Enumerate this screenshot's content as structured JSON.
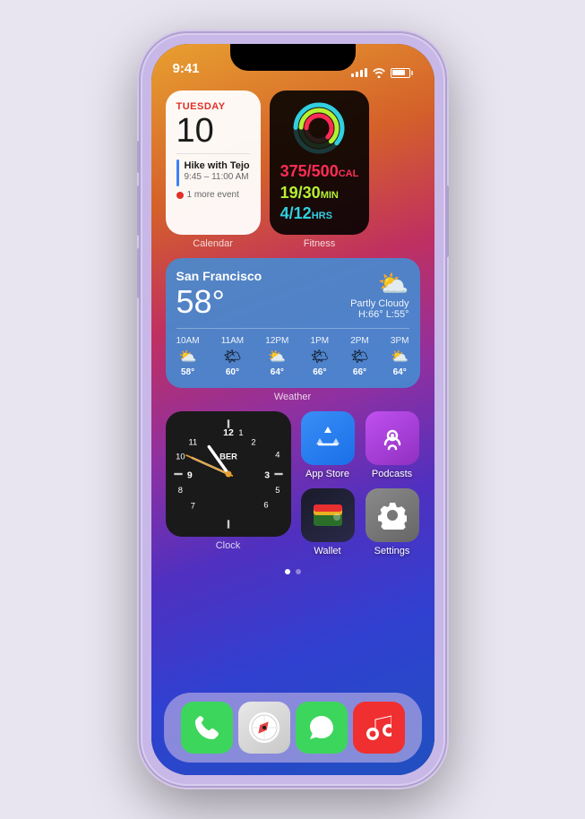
{
  "phone": {
    "status_bar": {
      "time": "9:41"
    },
    "widgets": {
      "calendar": {
        "label": "Calendar",
        "day": "TUESDAY",
        "date": "10",
        "event_title": "Hike with Tejo",
        "event_time": "9:45 – 11:00 AM",
        "more_events": "1 more event"
      },
      "fitness": {
        "label": "Fitness",
        "move": "375/500",
        "move_unit": "CAL",
        "exercise": "19/30",
        "exercise_unit": "MIN",
        "stand": "4/12",
        "stand_unit": "HRS"
      },
      "weather": {
        "label": "Weather",
        "city": "San Francisco",
        "temp": "58°",
        "condition": "Partly Cloudy",
        "high": "H:66°",
        "low": "L:55°",
        "hourly": [
          {
            "time": "10AM",
            "temp": "58°",
            "icon": "⛅"
          },
          {
            "time": "11AM",
            "temp": "60°",
            "icon": "🌤"
          },
          {
            "time": "12PM",
            "temp": "64°",
            "icon": "⛅"
          },
          {
            "time": "1PM",
            "temp": "66°",
            "icon": "🌤"
          },
          {
            "time": "2PM",
            "temp": "66°",
            "icon": "🌤"
          },
          {
            "time": "3PM",
            "temp": "64°",
            "icon": "⛅"
          }
        ]
      },
      "clock": {
        "label": "Clock",
        "timezone": "BER",
        "hour": 10,
        "minute": 49
      }
    },
    "apps": {
      "app_store": {
        "label": "App Store"
      },
      "podcasts": {
        "label": "Podcasts"
      },
      "wallet": {
        "label": "Wallet"
      },
      "settings": {
        "label": "Settings"
      }
    },
    "dock": {
      "phone": {
        "label": "Phone"
      },
      "safari": {
        "label": "Safari"
      },
      "messages": {
        "label": "Messages"
      },
      "music": {
        "label": "Music"
      }
    },
    "page_dots": {
      "current": 0,
      "total": 2
    }
  }
}
